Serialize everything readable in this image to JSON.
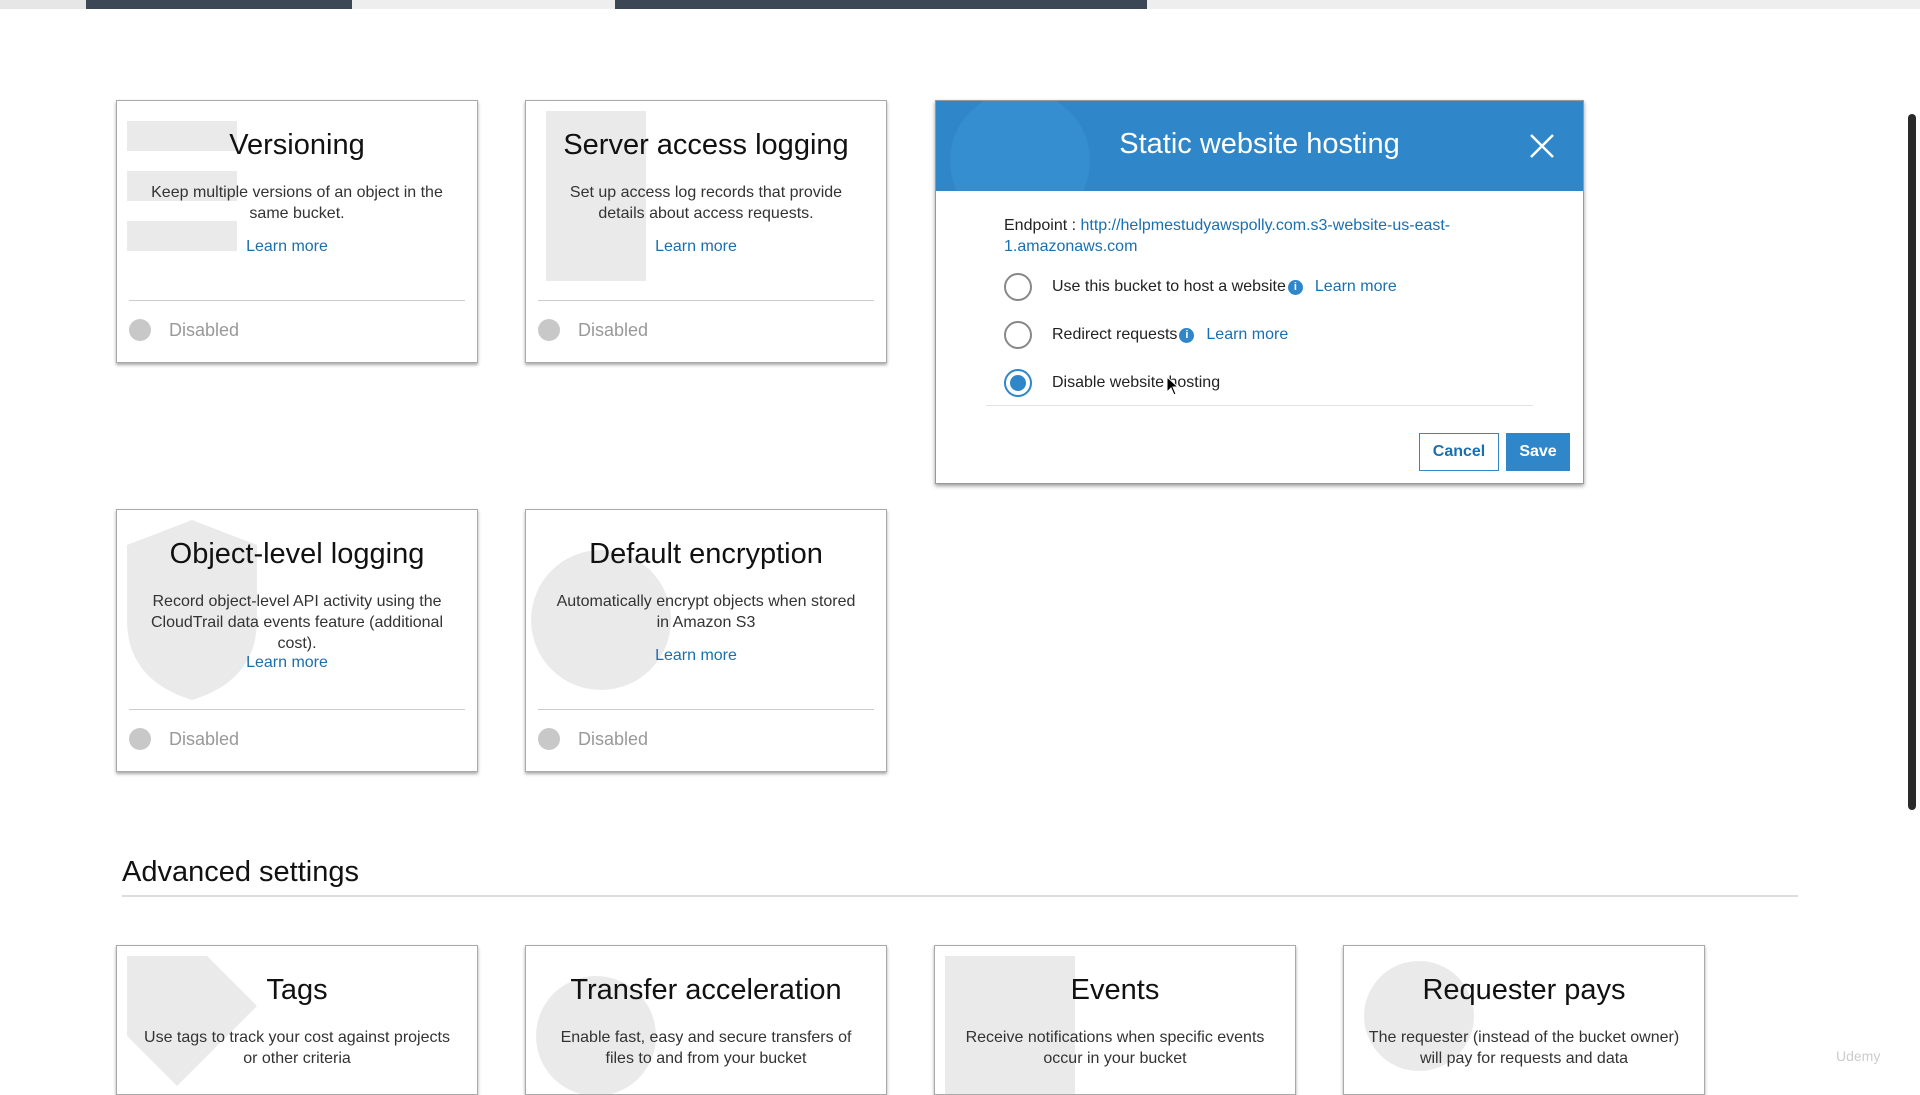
{
  "cards": [
    {
      "title": "Versioning",
      "desc": "Keep multiple versions of an object in the same bucket.",
      "learn": "Learn more",
      "status": "Disabled"
    },
    {
      "title": "Server access logging",
      "desc": "Set up access log records that provide details about access requests.",
      "learn": "Learn more",
      "status": "Disabled"
    },
    {
      "title": "Object-level logging",
      "desc": "Record object-level API activity using the CloudTrail data events feature (additional cost).",
      "learn": "Learn more",
      "status": "Disabled"
    },
    {
      "title": "Default encryption",
      "desc": "Automatically encrypt objects when stored in Amazon S3",
      "learn": "Learn more",
      "status": "Disabled"
    }
  ],
  "modal": {
    "title": "Static website hosting",
    "endpoint_label": "Endpoint : ",
    "endpoint_url": "http://helpmestudyawspolly.com.s3-website-us-east-1.amazonaws.com",
    "options": [
      {
        "label": "Use this bucket to host a website",
        "learn": "Learn more",
        "selected": false
      },
      {
        "label": "Redirect requests",
        "learn": "Learn more",
        "selected": false
      },
      {
        "label": "Disable website hosting",
        "selected": true
      }
    ],
    "cancel": "Cancel",
    "save": "Save"
  },
  "advanced": {
    "heading": "Advanced settings",
    "cards": [
      {
        "title": "Tags",
        "desc": "Use tags to track your cost against projects or other criteria"
      },
      {
        "title": "Transfer acceleration",
        "desc": "Enable fast, easy and secure transfers of files to and from your bucket"
      },
      {
        "title": "Events",
        "desc": "Receive notifications when specific events occur in your bucket"
      },
      {
        "title": "Requester pays",
        "desc": "The requester (instead of the bucket owner) will pay for requests and data"
      }
    ]
  },
  "watermark": "Udemy",
  "colors": {
    "accent": "#2f87c9",
    "link": "#1a6fb0",
    "disabled_dot": "#c8c8c8"
  }
}
